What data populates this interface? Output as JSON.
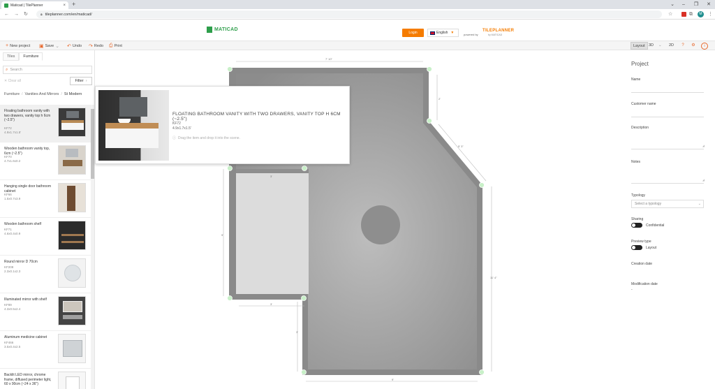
{
  "browser": {
    "tab_title": "Maticad | TilePlanner",
    "url": "tileplanner.com/en/maticad/",
    "avatar_letter": "M"
  },
  "header": {
    "logo_text": "MATICAD",
    "login_label": "Login",
    "language": "English",
    "powered_by": "powered by",
    "brand": "TILEPLANNER",
    "brand_sub": "by MATICAD"
  },
  "toolbar": {
    "new_project": "New project",
    "save": "Save",
    "undo": "Undo",
    "redo": "Redo",
    "print": "Print",
    "view_layout": "Layout",
    "view_3d": "3D",
    "view_2d": "2D",
    "help": "?"
  },
  "left": {
    "tabs": [
      "Tiles",
      "Furniture"
    ],
    "search_placeholder": "Search",
    "clear_all": "Clear all",
    "filter": "Filter",
    "breadcrumb": [
      "Furniture",
      "Vanities And Mirrors",
      "St Modern"
    ],
    "items": [
      {
        "name": "Floating bathroom vanity with two drawers, vanity top h 6cm (~2.5\")",
        "code": "KF72",
        "dims": "4.9x1.7x1.5'",
        "thumb": "vanity"
      },
      {
        "name": "Wooden bathroom vanity top, 6cm (~2.5\")",
        "code": "KF70",
        "dims": "4.7x1.6x0.2",
        "thumb": "wood"
      },
      {
        "name": "Hanging single door bathroom cabinet",
        "code": "KF66",
        "dims": "1.5x0.7x3.9",
        "thumb": "hang"
      },
      {
        "name": "Wooden bathroom shelf",
        "code": "KF71",
        "dims": "4.6x0.4x0.9",
        "thumb": "shelf"
      },
      {
        "name": "Round mirror D 70cm",
        "code": "KF208",
        "dims": "2.3x0.1x2.3",
        "thumb": "round"
      },
      {
        "name": "Illuminated mirror with shelf",
        "code": "KF89",
        "dims": "4.3x0.5x2.4",
        "thumb": "illum"
      },
      {
        "name": "Aluminum medicine cabinet",
        "code": "KF466",
        "dims": "3.5x0.4x2.5",
        "thumb": "alu"
      },
      {
        "name": "Backlit LED mirror, chrome frame, diffused perimeter light, 60 x 90cm (~24 x 36\")",
        "code": "",
        "dims": "",
        "thumb": "led"
      }
    ]
  },
  "popup": {
    "title": "FLOATING BATHROOM VANITY WITH TWO DRAWERS, VANITY TOP H 6CM (~2.5\")",
    "code": "KF72",
    "dims": "4.9x1.7x1.5'",
    "hint": "Drag the item and drop it into the scene."
  },
  "canvas": {
    "dims": {
      "top": "7' 10\"",
      "upper_right": "2'",
      "diagonal": "5' 3\"",
      "left": "9'",
      "right": "11' 4\"",
      "lower_left": "3'",
      "bottom": "9'",
      "sink_top": "3'",
      "inner_bottom": "3'"
    }
  },
  "right": {
    "title": "Project",
    "name_label": "Name",
    "customer_label": "Customer name",
    "description_label": "Description",
    "notes_label": "Notes",
    "typology_label": "Typology",
    "typology_placeholder": "Select a typology",
    "sharing_label": "Sharing",
    "sharing_value": "Confidential",
    "preview_label": "Preview type",
    "preview_value": "Layout",
    "creation_label": "Creation date",
    "modification_label": "Modification date",
    "modification_value": "-"
  }
}
